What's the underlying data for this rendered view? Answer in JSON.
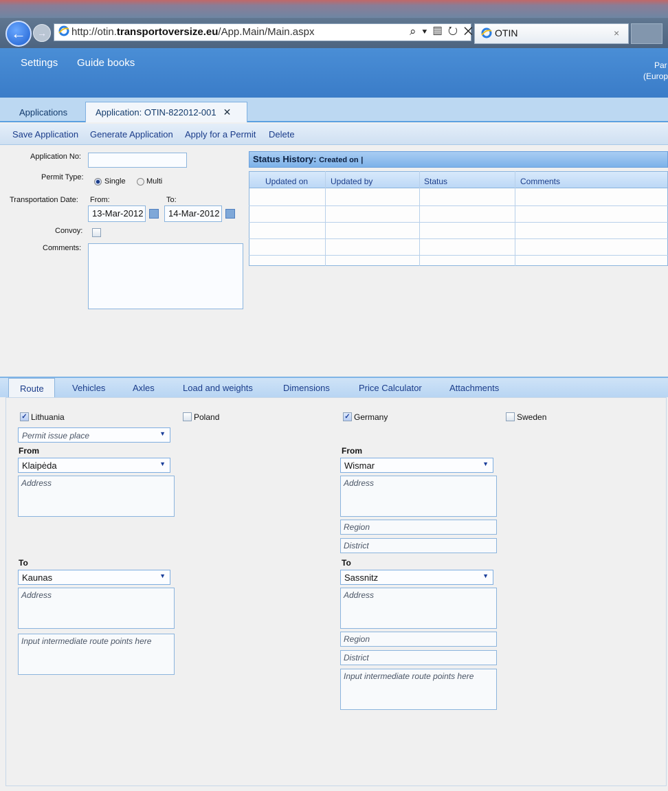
{
  "browser": {
    "url_prefix": "http://otin.",
    "url_host": "transportoversize.eu",
    "url_path": "/App.Main/Main.aspx",
    "address_tools": "⌕ ▾ ▤ ↻ ✕",
    "tab_title": "OTIN",
    "tab_close": "×",
    "back_glyph": "←",
    "forward_glyph": "→"
  },
  "header": {
    "links": [
      "Settings",
      "Guide books"
    ],
    "user_line1": "Par",
    "user_line2": "(Europ"
  },
  "app_tabs": {
    "applications": "Applications",
    "detail": "Application: OTIN-822012-001",
    "detail_close": "✕"
  },
  "actions": [
    "Save Application",
    "Generate Application",
    "Apply for a Permit",
    "Delete"
  ],
  "form": {
    "application_no_label": "Application No:",
    "application_no_value": "",
    "permit_type_label": "Permit Type:",
    "permit_options": [
      "Single",
      "Multi"
    ],
    "permit_selected": "Single",
    "transport_date_label": "Transportation Date:",
    "from_label": "From:",
    "to_label": "To:",
    "from_date": "13-Mar-2012",
    "to_date": "14-Mar-2012",
    "convoy_label": "Convoy:",
    "convoy_checked": false,
    "comments_label": "Comments:"
  },
  "status_history": {
    "title": "Status History:",
    "subtitle": "Created on",
    "separator": "|",
    "columns": [
      "Updated on",
      "Updated by",
      "Status",
      "Comments"
    ],
    "rows": []
  },
  "route_tabs": [
    "Route",
    "Vehicles",
    "Axles",
    "Load and weights",
    "Dimensions",
    "Price Calculator",
    "Attachments"
  ],
  "route": {
    "countries": [
      {
        "name": "Lithuania",
        "checked": true
      },
      {
        "name": "Poland",
        "checked": false
      },
      {
        "name": "Germany",
        "checked": true
      },
      {
        "name": "Sweden",
        "checked": false
      }
    ],
    "permit_issue_place_placeholder": "Permit issue place",
    "from_label": "From",
    "to_label": "To",
    "lithuania": {
      "from_value": "Klaipėda",
      "to_value": "Kaunas"
    },
    "germany": {
      "from_value": "Wismar",
      "to_value": "Sassnitz"
    },
    "address_placeholder": "Address",
    "region_placeholder": "Region",
    "district_placeholder": "District",
    "intermediate_placeholder": "Input intermediate route points here"
  },
  "colors": {
    "header_blue": "#3f84ce",
    "link_blue": "#1a3c8a",
    "border_blue": "#8bb4dd"
  }
}
